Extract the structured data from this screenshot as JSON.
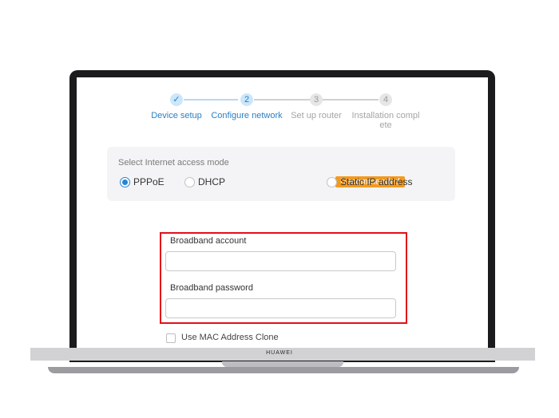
{
  "device": {
    "brand": "HUAWEI"
  },
  "wizard": {
    "steps": [
      {
        "number": "✓",
        "label": "Device setup",
        "state": "done"
      },
      {
        "number": "2",
        "label": "Configure network",
        "state": "active"
      },
      {
        "number": "3",
        "label": "Set up router",
        "state": "todo"
      },
      {
        "number": "4",
        "label": "Installation complete",
        "label_line1": "Installation compl",
        "label_line2": "ete",
        "state": "todo"
      }
    ]
  },
  "access_mode": {
    "title": "Select Internet access mode",
    "options": [
      {
        "label": "PPPoE",
        "selected": true
      },
      {
        "label": "DHCP",
        "selected": false,
        "badge": "Recommended"
      },
      {
        "label": "Static IP address",
        "selected": false
      }
    ]
  },
  "form": {
    "account_label": "Broadband account",
    "account_value": "",
    "password_label": "Broadband password",
    "password_value": "",
    "mac_clone_label": "Use MAC Address Clone",
    "mac_clone_checked": false
  },
  "colors": {
    "accent": "#2386d4",
    "badge": "#f39a1f",
    "highlight": "#e1101a"
  }
}
